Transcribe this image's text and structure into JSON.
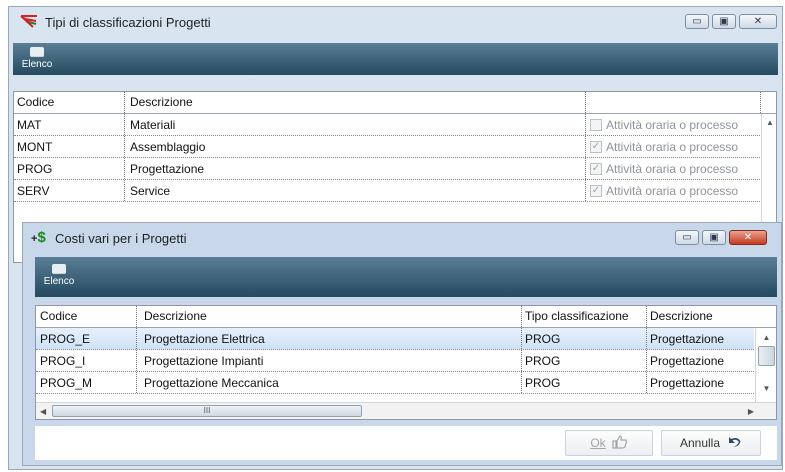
{
  "window1": {
    "title": "Tipi di classificazioni Progetti",
    "controls": {
      "minimize": "▭",
      "maximize": "▣",
      "close": "✕"
    },
    "toolbar": {
      "elenco_label": "Elenco"
    },
    "columns": [
      "Codice",
      "Descrizione",
      ""
    ],
    "rows": [
      {
        "code": "MAT",
        "desc": "Materiali",
        "check": "Attività oraria o processo",
        "checked": false
      },
      {
        "code": "MONT",
        "desc": "Assemblaggio",
        "check": "Attività oraria o processo",
        "checked": true
      },
      {
        "code": "PROG",
        "desc": "Progettazione",
        "check": "Attività oraria o processo",
        "checked": true
      },
      {
        "code": "SERV",
        "desc": "Service",
        "check": "Attività oraria o processo",
        "checked": true
      }
    ]
  },
  "window2": {
    "title": "Costi vari per i Progetti",
    "controls": {
      "minimize": "▭",
      "maximize": "▣",
      "close": "✕"
    },
    "toolbar": {
      "elenco_label": "Elenco"
    },
    "columns": [
      "Codice",
      "Descrizione",
      "Tipo classificazione",
      "Descrizione"
    ],
    "rows": [
      {
        "code": "PROG_E",
        "desc": "Progettazione Elettrica",
        "tipo": "PROG",
        "desc2": "Progettazione"
      },
      {
        "code": "PROG_I",
        "desc": "Progettazione Impianti",
        "tipo": "PROG",
        "desc2": "Progettazione"
      },
      {
        "code": "PROG_M",
        "desc": "Progettazione Meccanica",
        "tipo": "PROG",
        "desc2": "Progettazione"
      }
    ],
    "hscroll_grip": "III",
    "buttons": {
      "ok": "Ok",
      "cancel": "Annulla"
    }
  },
  "icons": {
    "app1": "red-tree-icon",
    "app2": "money-plus-icon",
    "elenco": "printer-icon",
    "ok": "thumbs-up-icon",
    "cancel": "undo-arrow-icon"
  },
  "colors": {
    "toolbar": "#2f5670",
    "title_bg": "#d9e4f1",
    "close_red": "#c4391f"
  }
}
